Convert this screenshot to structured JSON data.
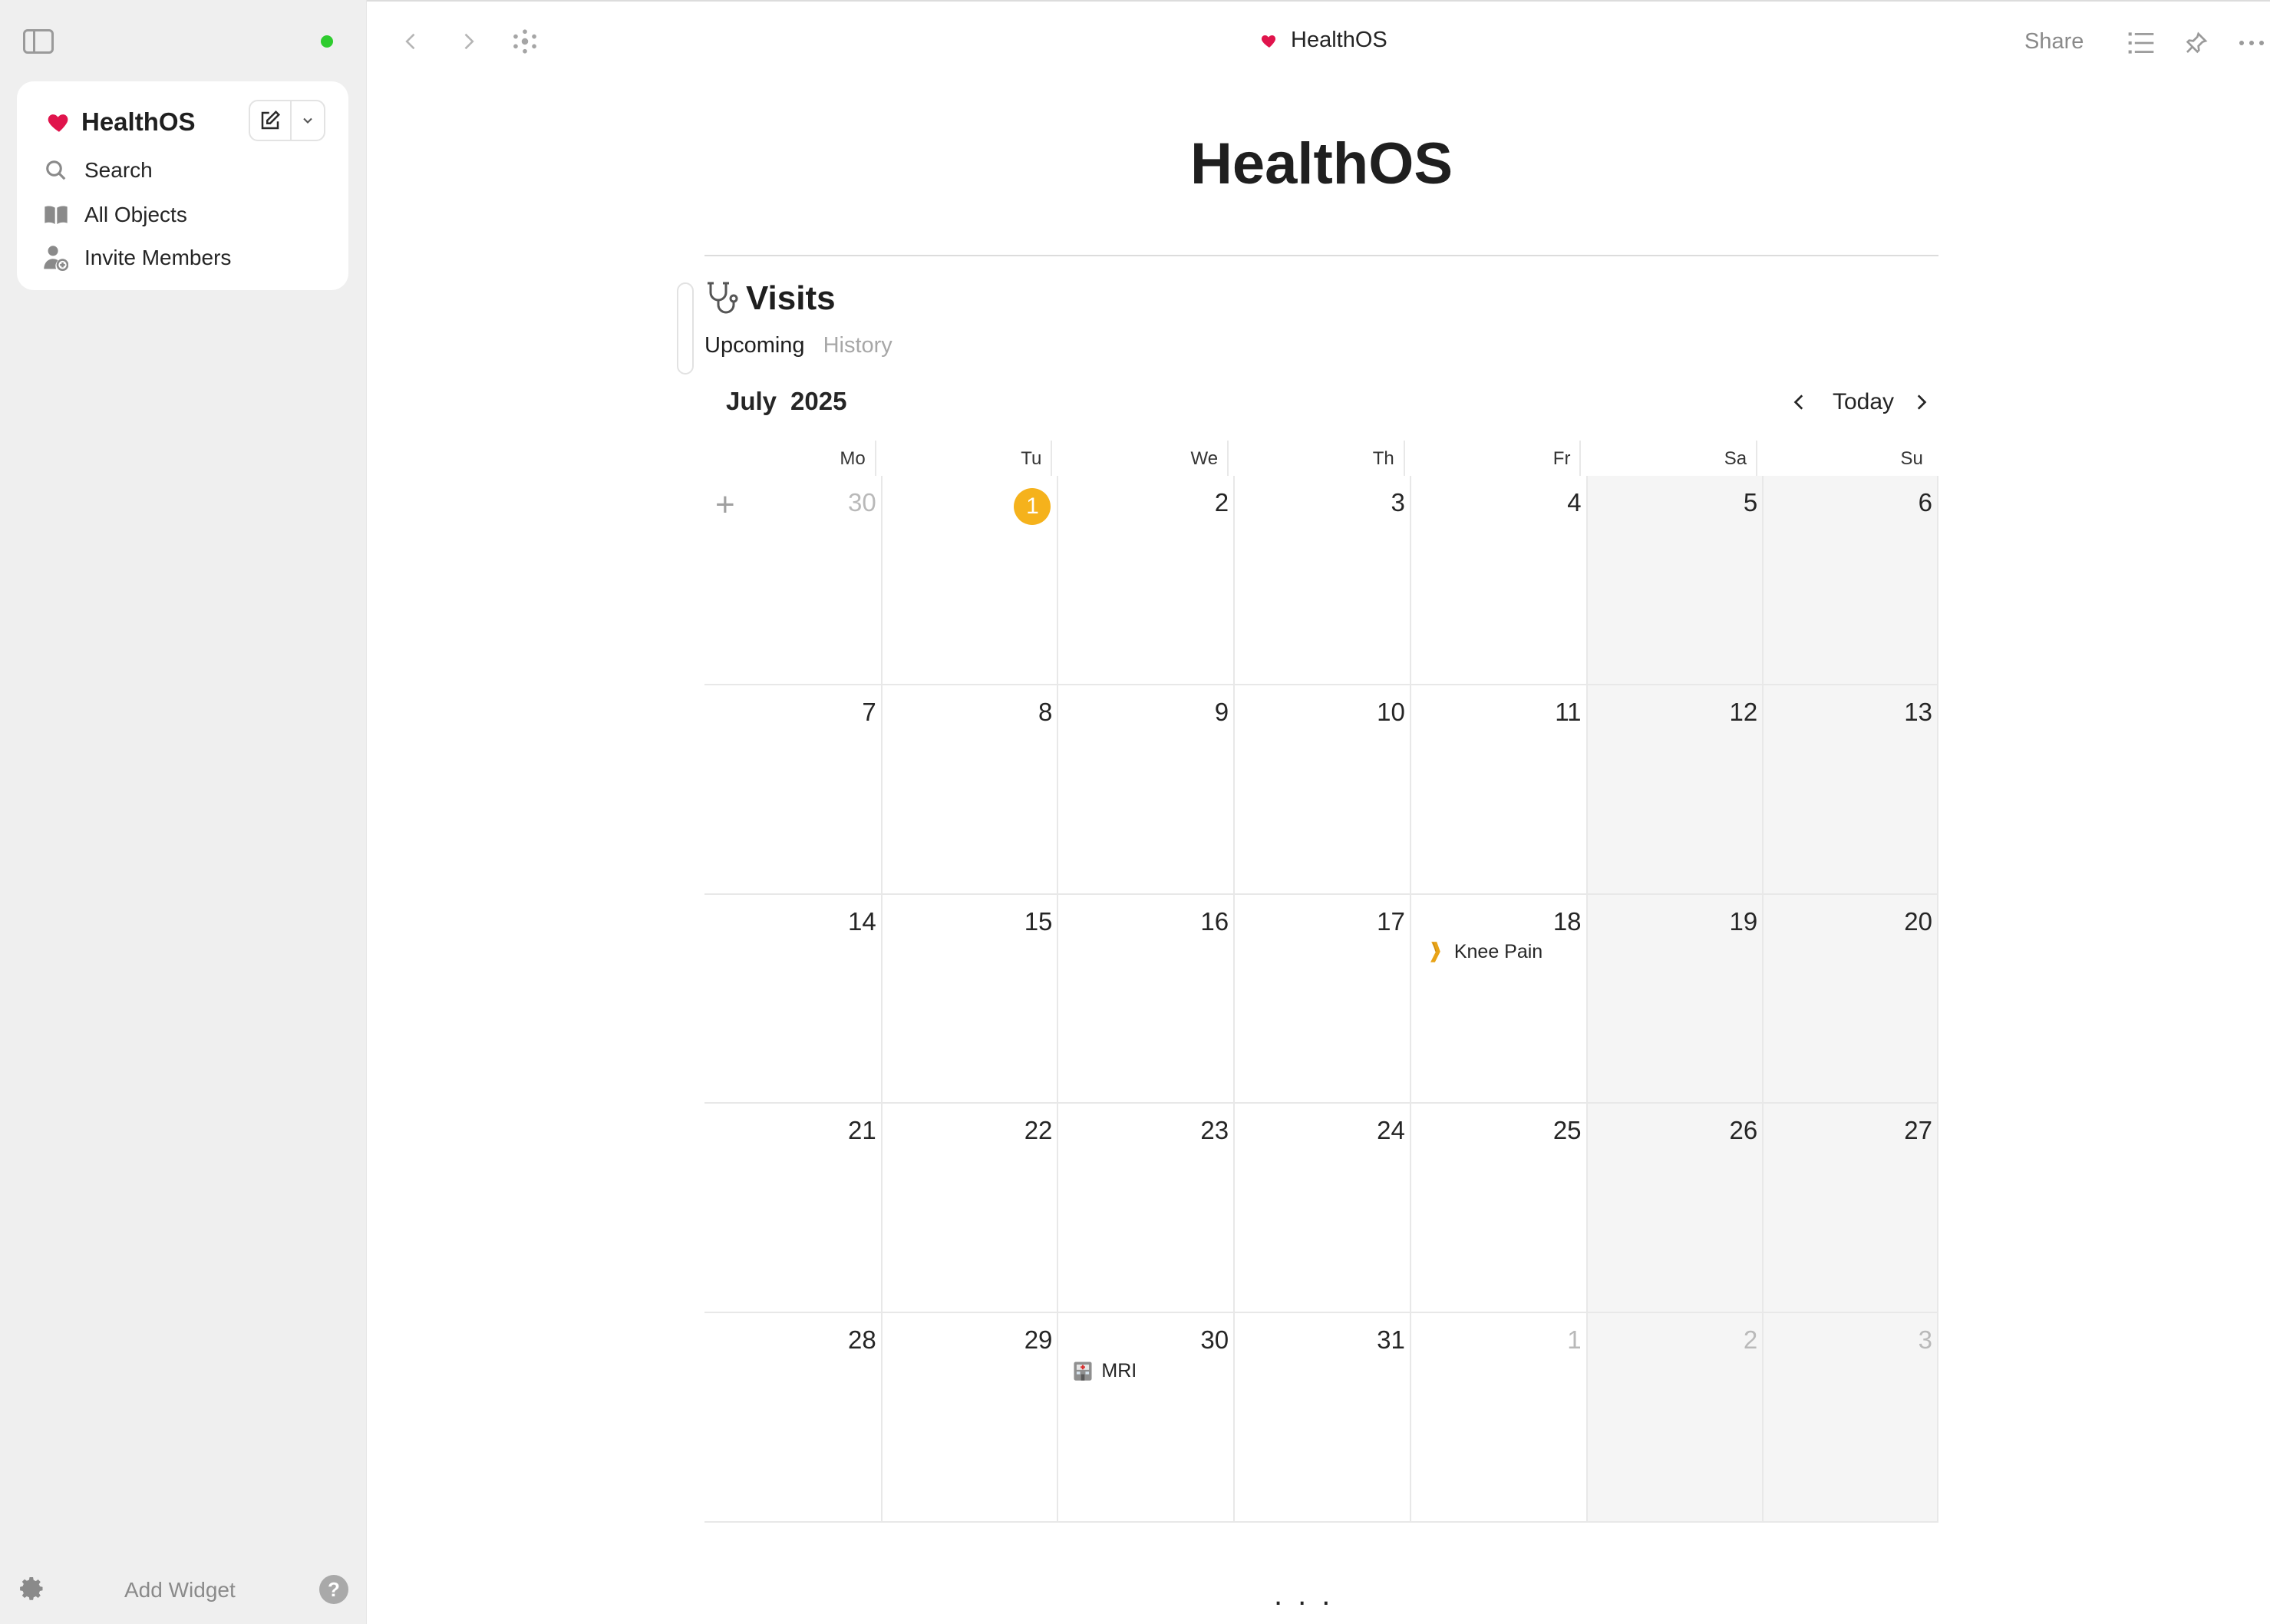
{
  "sidebar": {
    "space_name": "HealthOS",
    "items": [
      {
        "label": "Search",
        "icon": "search-icon"
      },
      {
        "label": "All Objects",
        "icon": "book-icon"
      },
      {
        "label": "Invite Members",
        "icon": "invite-member-icon"
      }
    ],
    "add_widget_label": "Add Widget",
    "help_label": "?",
    "status_color": "#2ecc2e"
  },
  "topbar": {
    "title": "HealthOS",
    "share_label": "Share"
  },
  "page": {
    "title": "HealthOS"
  },
  "widget": {
    "title": "Visits",
    "icon": "stethoscope-icon",
    "tabs": [
      {
        "label": "Upcoming",
        "active": true
      },
      {
        "label": "History",
        "active": false
      }
    ]
  },
  "calendar": {
    "month": "July",
    "year": "2025",
    "today_label": "Today",
    "weekdays": [
      "Mo",
      "Tu",
      "We",
      "Th",
      "Fr",
      "Sa",
      "Su"
    ],
    "weeks": [
      [
        "30",
        "1",
        "2",
        "3",
        "4",
        "5",
        "6"
      ],
      [
        "7",
        "8",
        "9",
        "10",
        "11",
        "12",
        "13"
      ],
      [
        "14",
        "15",
        "16",
        "17",
        "18",
        "19",
        "20"
      ],
      [
        "21",
        "22",
        "23",
        "24",
        "25",
        "26",
        "27"
      ],
      [
        "28",
        "29",
        "30",
        "31",
        "1",
        "2",
        "3"
      ]
    ],
    "events": [
      {
        "label": "Knee Pain",
        "icon": "leg-icon",
        "week": 2,
        "day": 4
      },
      {
        "label": "MRI",
        "icon": "hospital-icon",
        "week": 4,
        "day": 2
      }
    ],
    "today_color": "#f5b21c",
    "heart_color": "#e0144c"
  },
  "footer": {
    "more_label": "..."
  }
}
